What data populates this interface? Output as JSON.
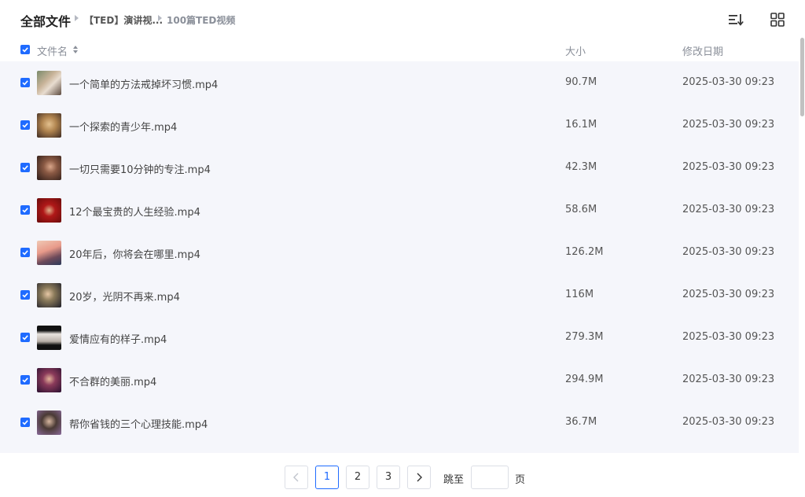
{
  "breadcrumb": {
    "root": "全部文件",
    "items": [
      "【TED】演讲视...",
      "100篇TED视频"
    ]
  },
  "toolbar": {
    "sort_icon": "sort-list-icon",
    "grid_icon": "grid-view-icon"
  },
  "table": {
    "columns": {
      "name": "文件名",
      "size": "大小",
      "date": "修改日期"
    },
    "rows": [
      {
        "name": "一个简单的方法戒掉坏习惯.mp4",
        "size": "90.7M",
        "date": "2025-03-30 09:23"
      },
      {
        "name": "一个探索的青少年.mp4",
        "size": "16.1M",
        "date": "2025-03-30 09:23"
      },
      {
        "name": "一切只需要10分钟的专注.mp4",
        "size": "42.3M",
        "date": "2025-03-30 09:23"
      },
      {
        "name": "12个最宝贵的人生经验.mp4",
        "size": "58.6M",
        "date": "2025-03-30 09:23"
      },
      {
        "name": "20年后，你将会在哪里.mp4",
        "size": "126.2M",
        "date": "2025-03-30 09:23"
      },
      {
        "name": "20岁，光阴不再来.mp4",
        "size": "116M",
        "date": "2025-03-30 09:23"
      },
      {
        "name": "爱情应有的样子.mp4",
        "size": "279.3M",
        "date": "2025-03-30 09:23"
      },
      {
        "name": "不合群的美丽.mp4",
        "size": "294.9M",
        "date": "2025-03-30 09:23"
      },
      {
        "name": "帮你省钱的三个心理技能.mp4",
        "size": "36.7M",
        "date": "2025-03-30 09:23"
      }
    ]
  },
  "pagination": {
    "pages": [
      "1",
      "2",
      "3"
    ],
    "current": "1",
    "jump_label": "跳至",
    "page_unit": "页",
    "jump_value": ""
  },
  "colors": {
    "accent": "#1f6bff",
    "row_bg": "#f5f6fb"
  }
}
